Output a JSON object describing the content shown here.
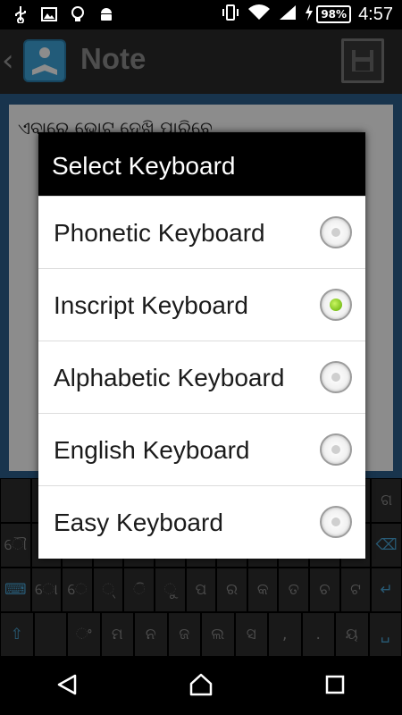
{
  "status_bar": {
    "icons": [
      "usb-icon",
      "image-icon",
      "lightbulb-icon",
      "android-icon"
    ],
    "battery": "98%",
    "time": "4:57"
  },
  "app_bar": {
    "title": "Note"
  },
  "note": {
    "text": "ଏବାରେ ଭୋଟ୍ ଦେଖି ପାରିବେ"
  },
  "dialog": {
    "title": "Select Keyboard",
    "options": [
      {
        "label": "Phonetic Keyboard",
        "selected": false
      },
      {
        "label": "Inscript Keyboard",
        "selected": true
      },
      {
        "label": "Alphabetic Keyboard",
        "selected": false
      },
      {
        "label": "English Keyboard",
        "selected": false
      },
      {
        "label": "Easy Keyboard",
        "selected": false
      }
    ]
  },
  "keyboard": {
    "row1": [
      "",
      "",
      "",
      "",
      "",
      "",
      "",
      "",
      "",
      "",
      "",
      "",
      "ଗ"
    ],
    "row2": [
      "ୌ",
      "",
      "",
      "",
      "",
      "",
      "",
      "",
      "",
      "",
      "",
      "",
      "⌫"
    ],
    "row3": [
      "⌨",
      "ୋ",
      "େ",
      "୍",
      "ି",
      "ୁ",
      "ପ",
      "ର",
      "କ",
      "ତ",
      "ଚ",
      "ଟ",
      "↵"
    ],
    "row4": [
      "⇧",
      "",
      "ଂ",
      "ମ",
      "ନ",
      "ଜ",
      "ଲ",
      "ସ",
      ",",
      ".",
      "ୟ",
      "␣"
    ]
  },
  "colors": {
    "accent_green": "#7dc11d",
    "note_border": "#2d5f8c",
    "app_logo": "#3fa7dc"
  }
}
